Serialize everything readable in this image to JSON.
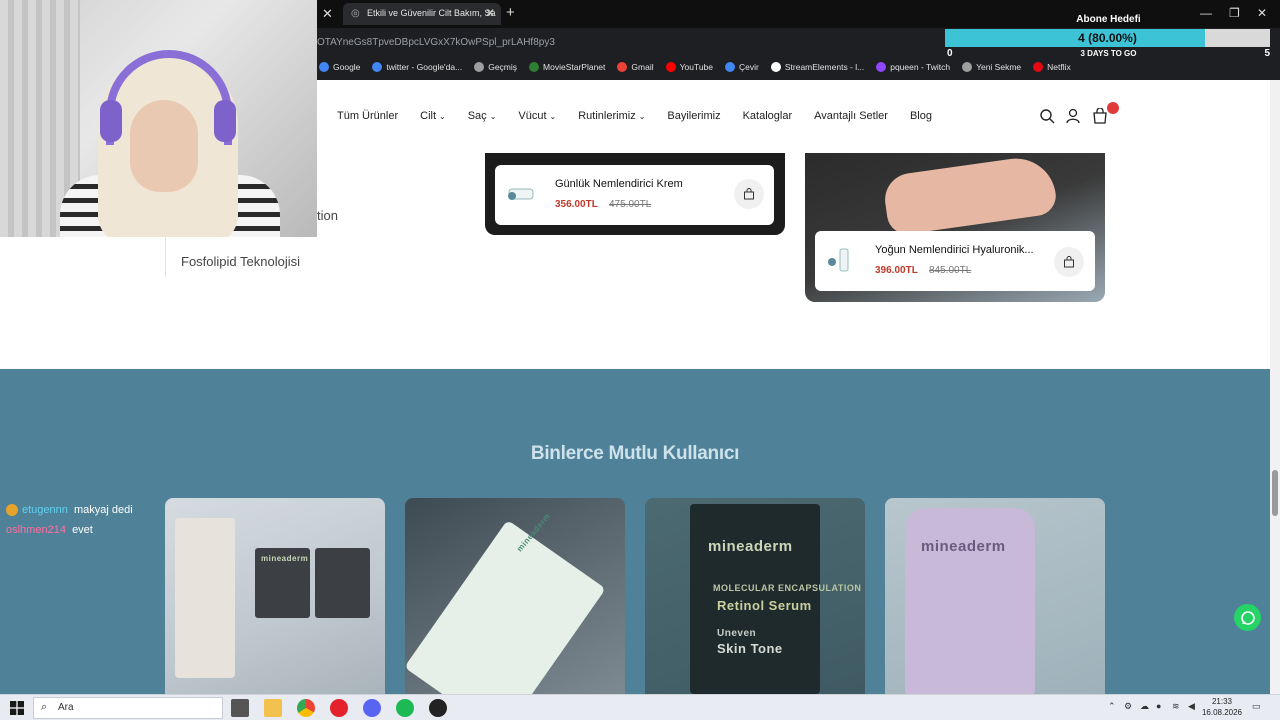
{
  "browser": {
    "tab_title": "Etkili ve Güvenilir Cilt Bakım, Sa",
    "url_fragment": "OTAYneGs8TpveDBpcLVGxX7kOwPSpl_prLAHf8py3",
    "bookmarks": [
      {
        "label": "Google",
        "color": "#4285f4"
      },
      {
        "label": "twitter - Google'da...",
        "color": "#4285f4"
      },
      {
        "label": "Geçmiş",
        "color": "#9e9e9e"
      },
      {
        "label": "MovieStarPlanet",
        "color": "#2e7d32"
      },
      {
        "label": "Gmail",
        "color": "#ea4335"
      },
      {
        "label": "YouTube",
        "color": "#ff0000"
      },
      {
        "label": "Çevir",
        "color": "#4285f4"
      },
      {
        "label": "StreamElements - l...",
        "color": "#ffffff"
      },
      {
        "label": "pqueen - Twitch",
        "color": "#9146ff"
      },
      {
        "label": "Yeni Sekme",
        "color": "#9e9e9e"
      },
      {
        "label": "Netflix",
        "color": "#e50914"
      }
    ]
  },
  "stream_goal": {
    "title": "Abone Hedefi",
    "progress_text": "4 (80.00%)",
    "progress_fraction": 0.8,
    "min": "0",
    "max": "5",
    "days_left": "3 DAYS TO GO"
  },
  "site": {
    "nav": [
      {
        "label": "Tüm Ürünler",
        "chevron": false
      },
      {
        "label": "Cilt",
        "chevron": true
      },
      {
        "label": "Saç",
        "chevron": true
      },
      {
        "label": "Vücut",
        "chevron": true
      },
      {
        "label": "Rutinlerimiz",
        "chevron": true
      },
      {
        "label": "Bayilerimiz",
        "chevron": false
      },
      {
        "label": "Kataloglar",
        "chevron": false
      },
      {
        "label": "Avantajlı Setler",
        "chevron": false
      },
      {
        "label": "Blog",
        "chevron": false
      }
    ],
    "feature_partial": "tion",
    "feature_text": "Fosfolipid Teknolojisi",
    "products": [
      {
        "name": "Günlük Nemlendirici Krem",
        "price": "356.00TL",
        "old_price": "475.00TL"
      },
      {
        "name": "Yoğun Nemlendirici Hyaluronik...",
        "price": "396.00TL",
        "old_price": "845.00TL"
      }
    ],
    "happy_title": "Binlerce Mutlu Kullanıcı",
    "gallery": [
      {
        "label": "mineaderm",
        "sub": ""
      },
      {
        "label": "mineaderm",
        "sub": ""
      },
      {
        "label": "mineaderm",
        "sub": "Retinol Serum",
        "sub2": "Skin Tone",
        "sub3": "MOLECULAR ENCAPSULATION",
        "sub4": "Uneven"
      },
      {
        "label": "mineaderm",
        "sub": ""
      }
    ]
  },
  "chat": [
    {
      "user": "etugennn",
      "message": "makyaj dedi"
    },
    {
      "user": "oslhmen214",
      "message": "evet"
    }
  ],
  "taskbar": {
    "search_placeholder": "Ara",
    "time": "21:33",
    "date": "16.08.2026"
  }
}
